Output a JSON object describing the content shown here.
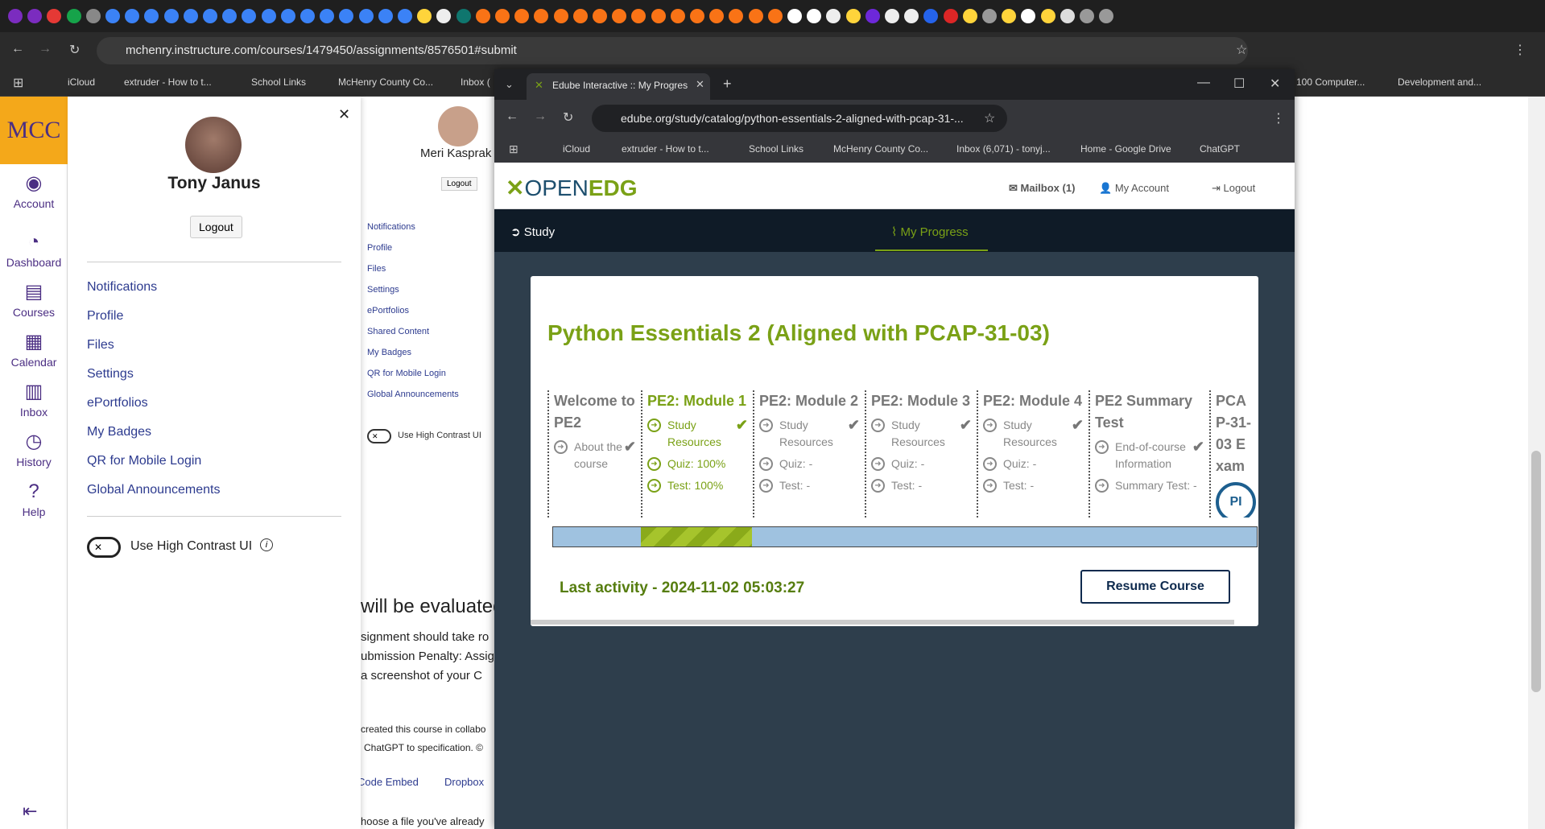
{
  "outer_browser": {
    "url": "mchenry.instructure.com/courses/1479450/assignments/8576501#submit",
    "bookmarks": [
      "iCloud",
      "extruder - How to t...",
      "School Links",
      "McHenry County Co...",
      "Inbox (",
      "100 Computer...",
      "Development and..."
    ]
  },
  "canvas": {
    "logo": "MCC",
    "global_nav": [
      "Account",
      "Dashboard",
      "Courses",
      "Calendar",
      "Inbox",
      "History",
      "Help"
    ],
    "tray": {
      "user_name": "Tony Janus",
      "logout": "Logout",
      "links": [
        "Notifications",
        "Profile",
        "Files",
        "Settings",
        "ePortfolios",
        "My Badges",
        "QR for Mobile Login",
        "Global Announcements"
      ],
      "high_contrast": "Use High Contrast UI"
    },
    "background": {
      "user_name": "Meri Kasprak",
      "logout": "Logout",
      "links": [
        "Notifications",
        "Profile",
        "Files",
        "Settings",
        "ePortfolios",
        "Shared Content",
        "My Badges",
        "QR for Mobile Login",
        "Global Announcements"
      ],
      "high_contrast": "Use High Contrast UI",
      "heading": "will be evaluated",
      "lines": [
        "signment should take ro",
        "ubmission Penalty: Assig",
        "a screenshot of your C"
      ],
      "footer1": "created this course in collabo",
      "footer2": "ChatGPT to specification. ©",
      "code_embed": "Code Embed",
      "dropbox": "Dropbox",
      "choose": "hoose a file you've already"
    }
  },
  "popup": {
    "tab_title": "Edube Interactive :: My Progress",
    "url": "edube.org/study/catalog/python-essentials-2-aligned-with-pcap-31-...",
    "bookmarks": [
      "iCloud",
      "extruder - How to t...",
      "School Links",
      "McHenry County Co...",
      "Inbox (6,071) - tonyj...",
      "Home - Google Drive",
      "ChatGPT"
    ],
    "site": {
      "brand_a": "OPEN",
      "brand_b": "EDG",
      "mailbox": "Mailbox (1)",
      "account": "My Account",
      "logout": "Logout",
      "nav_study": "Study",
      "nav_progress": "My Progress",
      "course_title": "Python Essentials 2 (Aligned with PCAP-31-03)",
      "modules": [
        {
          "title": "Welcome to PE2",
          "items": [
            "About the course"
          ]
        },
        {
          "title": "PE2: Module 1",
          "items": [
            "Study Resources",
            "Quiz: 100%",
            "Test: 100%"
          ]
        },
        {
          "title": "PE2: Module 2",
          "items": [
            "Study Resources",
            "Quiz: -",
            "Test: -"
          ]
        },
        {
          "title": "PE2: Module 3",
          "items": [
            "Study Resources",
            "Quiz: -",
            "Test: -"
          ]
        },
        {
          "title": "PE2: Module 4",
          "items": [
            "Study Resources",
            "Quiz: -",
            "Test: -"
          ]
        },
        {
          "title": "PE2 Summary Test",
          "items": [
            "End-of-course Information",
            "Summary Test: -"
          ]
        },
        {
          "title": "PCAP-31-03 Exam",
          "items": []
        }
      ],
      "last_activity": "Last activity - 2024-11-02 05:03:27",
      "resume": "Resume Course"
    }
  }
}
